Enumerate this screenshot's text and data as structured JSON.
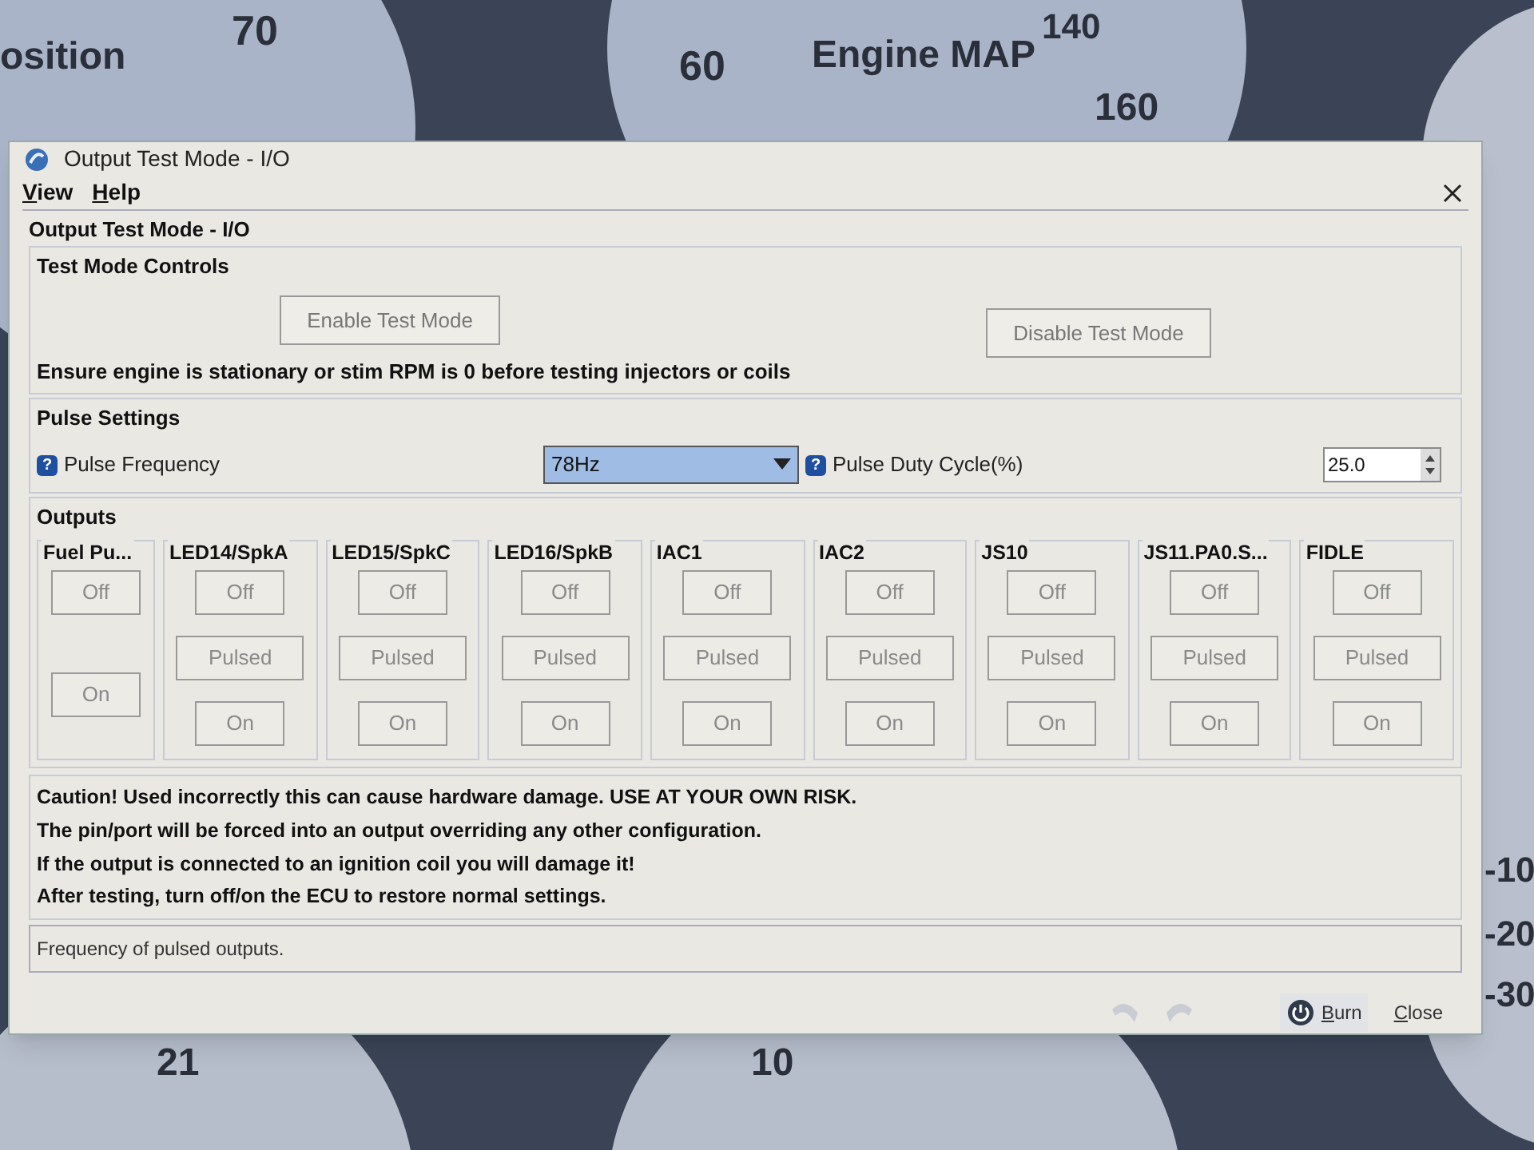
{
  "background_labels": [
    "osition",
    "70",
    "60",
    "Engine MAP",
    "140",
    "160",
    "21",
    "10",
    "-10",
    "-20",
    "-30"
  ],
  "window": {
    "title": "Output Test Mode - I/O"
  },
  "menu": [
    {
      "label": "View"
    },
    {
      "label": "Help"
    }
  ],
  "panel_title": "Output Test Mode - I/O",
  "test_mode_controls": {
    "title": "Test Mode Controls",
    "enable_button": "Enable Test Mode",
    "disable_button": "Disable Test Mode",
    "note": "Ensure engine is stationary or stim RPM is 0 before testing injectors or coils"
  },
  "pulse_settings": {
    "title": "Pulse Settings",
    "frequency_help": "?",
    "frequency_label": "Pulse Frequency",
    "frequency_value": "78Hz",
    "duty_help": "?",
    "duty_label": "Pulse Duty Cycle(%)",
    "duty_value": "25.0"
  },
  "outputs": {
    "title": "Outputs",
    "groups": [
      {
        "name": "Fuel Pu...",
        "buttons": [
          {
            "kind": "off",
            "label": "Off"
          },
          {
            "kind": "on",
            "label": "On"
          }
        ]
      },
      {
        "name": "LED14/SpkA",
        "buttons": [
          {
            "kind": "off",
            "label": "Off"
          },
          {
            "kind": "pulsed",
            "label": "Pulsed"
          },
          {
            "kind": "on",
            "label": "On"
          }
        ]
      },
      {
        "name": "LED15/SpkC",
        "buttons": [
          {
            "kind": "off",
            "label": "Off"
          },
          {
            "kind": "pulsed",
            "label": "Pulsed"
          },
          {
            "kind": "on",
            "label": "On"
          }
        ]
      },
      {
        "name": "LED16/SpkB",
        "buttons": [
          {
            "kind": "off",
            "label": "Off"
          },
          {
            "kind": "pulsed",
            "label": "Pulsed"
          },
          {
            "kind": "on",
            "label": "On"
          }
        ]
      },
      {
        "name": "IAC1",
        "buttons": [
          {
            "kind": "off",
            "label": "Off"
          },
          {
            "kind": "pulsed",
            "label": "Pulsed"
          },
          {
            "kind": "on",
            "label": "On"
          }
        ]
      },
      {
        "name": "IAC2",
        "buttons": [
          {
            "kind": "off",
            "label": "Off"
          },
          {
            "kind": "pulsed",
            "label": "Pulsed"
          },
          {
            "kind": "on",
            "label": "On"
          }
        ]
      },
      {
        "name": "JS10",
        "buttons": [
          {
            "kind": "off",
            "label": "Off"
          },
          {
            "kind": "pulsed",
            "label": "Pulsed"
          },
          {
            "kind": "on",
            "label": "On"
          }
        ]
      },
      {
        "name": "JS11.PA0.S...",
        "buttons": [
          {
            "kind": "off",
            "label": "Off"
          },
          {
            "kind": "pulsed",
            "label": "Pulsed"
          },
          {
            "kind": "on",
            "label": "On"
          }
        ]
      },
      {
        "name": "FIDLE",
        "buttons": [
          {
            "kind": "off",
            "label": "Off"
          },
          {
            "kind": "pulsed",
            "label": "Pulsed"
          },
          {
            "kind": "on",
            "label": "On"
          }
        ]
      }
    ]
  },
  "warnings": [
    "Caution! Used incorrectly this can cause hardware damage. USE AT YOUR OWN RISK.",
    "The pin/port will be forced into an output overriding any other configuration.",
    "If the output is connected to an ignition coil you will damage it!",
    "After testing, turn off/on the ECU to restore normal settings."
  ],
  "status_text": "Frequency of pulsed outputs.",
  "footer": {
    "burn_button": "Burn",
    "close_button": "Close"
  }
}
